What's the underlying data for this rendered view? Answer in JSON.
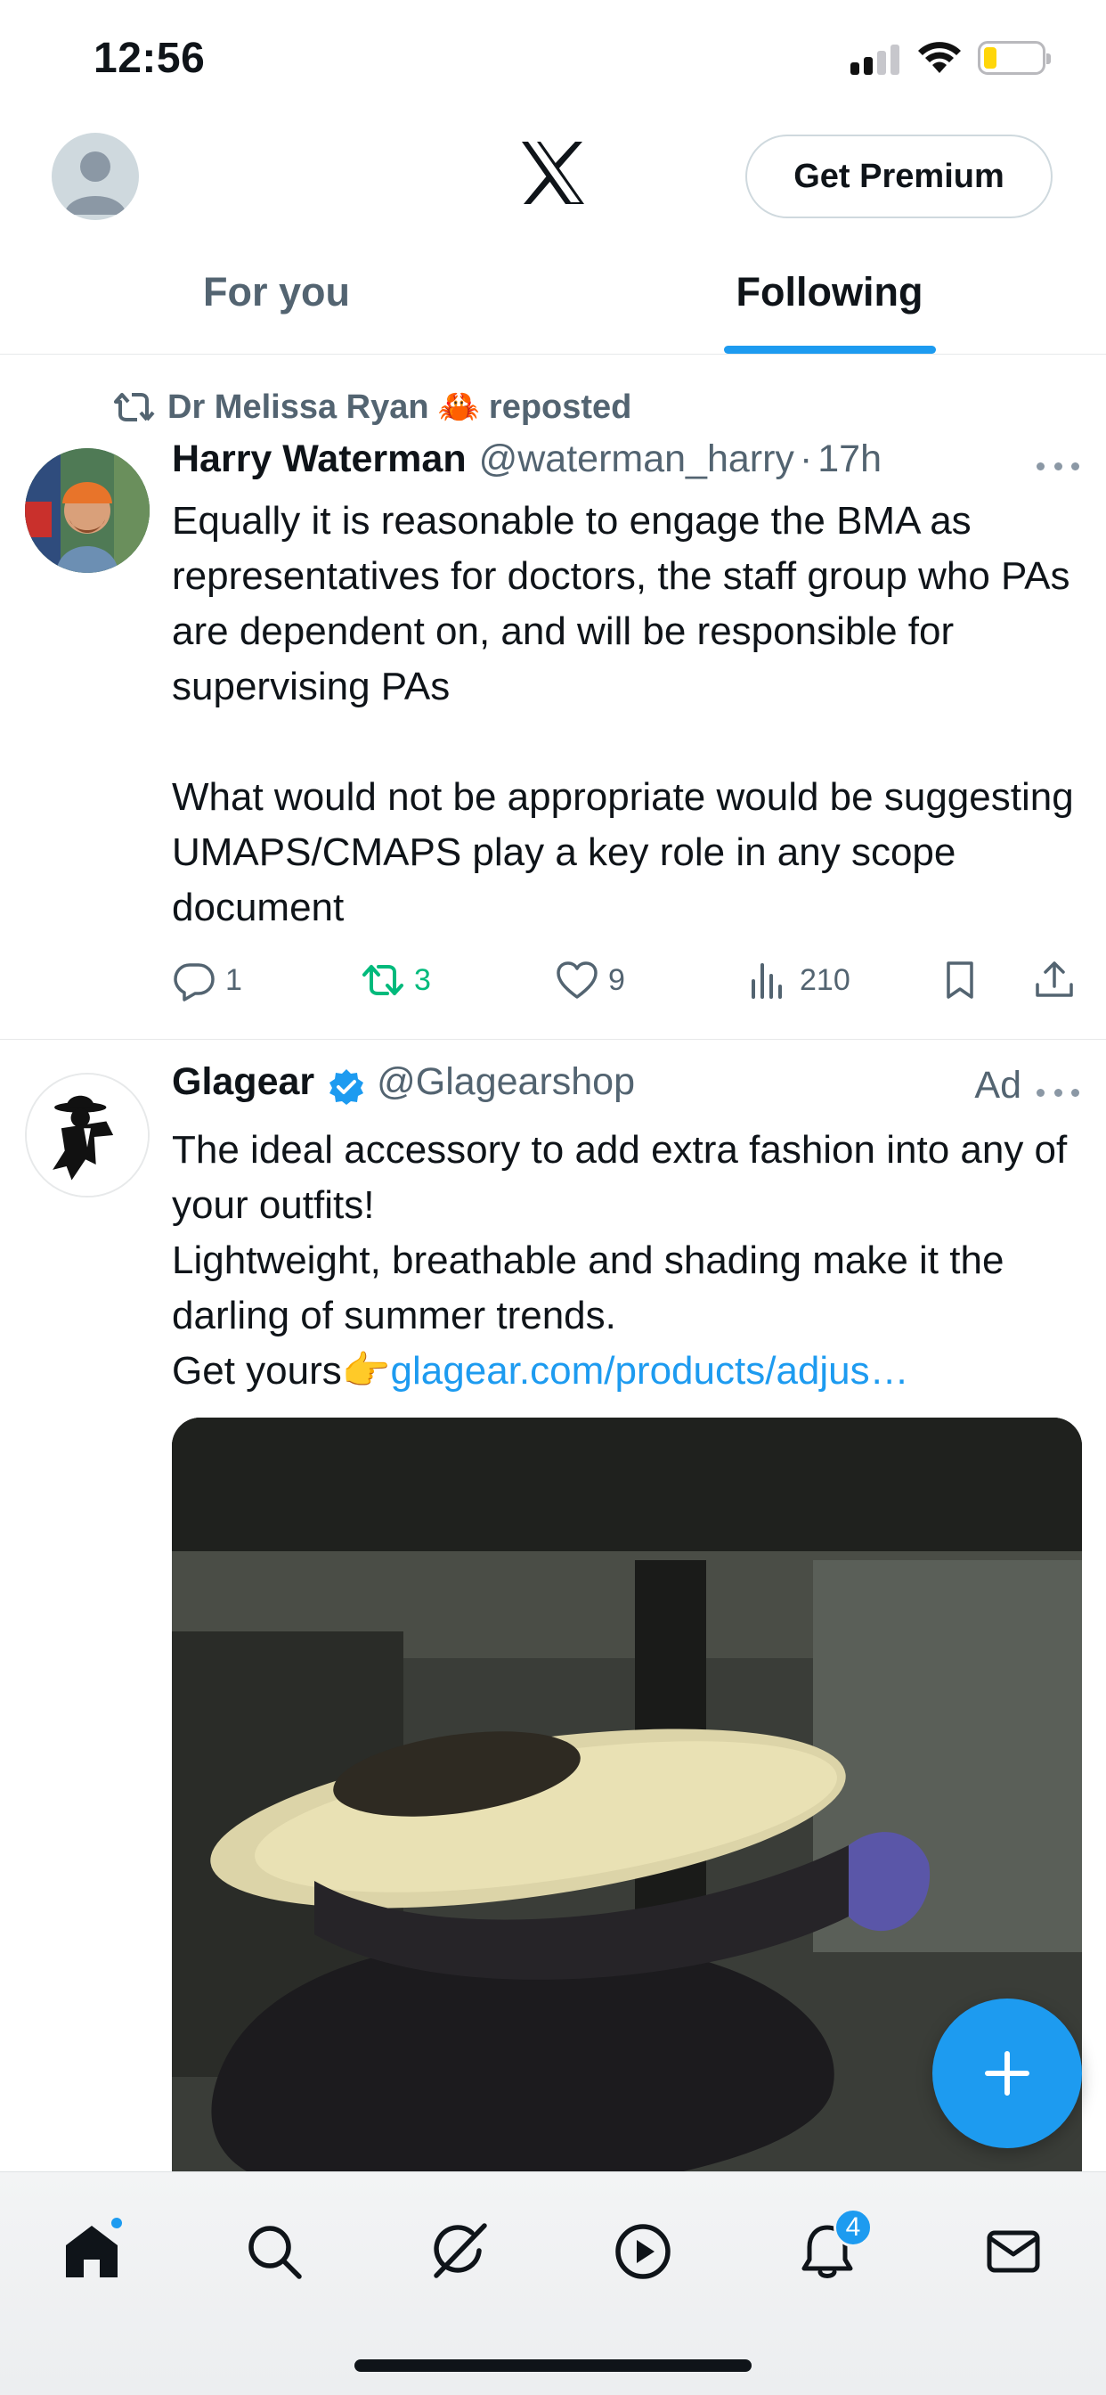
{
  "status_bar": {
    "time": "12:56",
    "signal_bars_active": 2,
    "battery_level": 0.15,
    "battery_color": "#ffd60a"
  },
  "header": {
    "logo_icon": "x-logo-icon",
    "premium_label": "Get Premium"
  },
  "tabs": [
    {
      "label": "For you",
      "active": false
    },
    {
      "label": "Following",
      "active": true
    }
  ],
  "tweets": [
    {
      "repost_by": "Dr Melissa Ryan",
      "repost_emoji": "🦀",
      "repost_suffix": "reposted",
      "author_name": "Harry Waterman",
      "author_handle": "@waterman_harry",
      "time_sep": "·",
      "time": "17h",
      "text": "Equally it is reasonable to engage the BMA as representatives for doctors, the staff group who PAs are dependent on, and will be responsible for supervising PAs\n\nWhat would not be appropriate would be suggesting UMAPS/CMAPS play a key role in any scope document",
      "replies": "1",
      "retweets": "3",
      "likes": "9",
      "views": "210"
    },
    {
      "author_name": "Glagear",
      "verified": true,
      "author_handle": "@Glagearshop",
      "ad_label": "Ad",
      "text": "The ideal accessory to add extra fashion into any of your outfits!\nLightweight, breathable and shading make it the darling of summer trends.\nGet yours👉",
      "link": "glagear.com/products/adjus…"
    }
  ],
  "bottom_nav": {
    "items": [
      "home-icon",
      "search-icon",
      "grok-icon",
      "video-icon",
      "notifications-icon",
      "messages-icon"
    ],
    "notifications_badge": "4"
  },
  "colors": {
    "accent": "#1d9bf0",
    "retweet": "#00ba7c",
    "muted": "#536471"
  }
}
